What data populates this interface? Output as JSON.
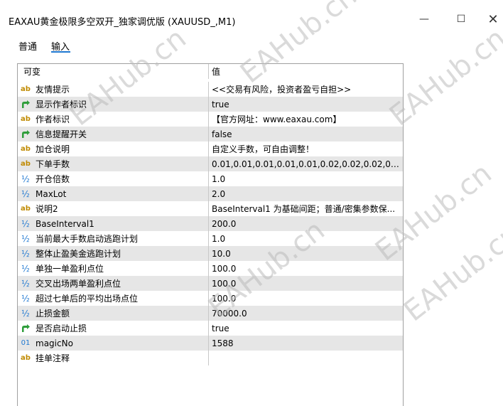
{
  "window": {
    "title": "EAXAU黄金极限多空双开_独家调优版 (XAUUSD_,M1)",
    "minimize_symbol": "—",
    "maximize_symbol": "☐",
    "close_symbol": "✕"
  },
  "tabs": [
    "普通",
    "输入"
  ],
  "table": {
    "header": {
      "name": "可变",
      "value": "值"
    },
    "rows": [
      {
        "icon": "ab",
        "name": "友情提示",
        "value": "<<交易有风险，投资者盈亏自担>>"
      },
      {
        "icon": "bool",
        "name": "显示作者标识",
        "value": "true"
      },
      {
        "icon": "ab",
        "name": "作者标识",
        "value": "【官方网址：www.eaxau.com】"
      },
      {
        "icon": "bool",
        "name": "信息提醒开关",
        "value": "false"
      },
      {
        "icon": "ab",
        "name": "加仓说明",
        "value": "自定义手数，可自由调整！"
      },
      {
        "icon": "ab",
        "name": "下单手数",
        "value": "0.01,0.01,0.01,0.01,0.01,0.02,0.02,0.02,0.02,0...."
      },
      {
        "icon": "half",
        "name": "开仓倍数",
        "value": "1.0"
      },
      {
        "icon": "half",
        "name": "MaxLot",
        "value": "2.0"
      },
      {
        "icon": "ab",
        "name": "说明2",
        "value": "BaseInterval1 为基础间距；普通/密集参数保..."
      },
      {
        "icon": "half",
        "name": "BaseInterval1",
        "value": "200.0"
      },
      {
        "icon": "half",
        "name": "当前最大手数启动逃跑计划",
        "value": "1.0"
      },
      {
        "icon": "half",
        "name": "整体止盈美金逃跑计划",
        "value": "10.0"
      },
      {
        "icon": "half",
        "name": "单独一单盈利点位",
        "value": "100.0"
      },
      {
        "icon": "half",
        "name": "交叉出场两单盈利点位",
        "value": "100.0"
      },
      {
        "icon": "half",
        "name": "超过七单后的平均出场点位",
        "value": "100.0"
      },
      {
        "icon": "half",
        "name": "止损金额",
        "value": "70000.0"
      },
      {
        "icon": "bool",
        "name": "是否启动止损",
        "value": "true"
      },
      {
        "icon": "01",
        "name": "magicNo",
        "value": "1588"
      },
      {
        "icon": "ab",
        "name": "挂单注释",
        "value": ""
      }
    ]
  },
  "watermark": "EAHub.cn",
  "colors": {
    "shaded_row": "#e6e6e6",
    "tab_accent": "#1f78d1",
    "ab_icon": "#c08a00",
    "half_icon": "#1f78d1",
    "bool_icon": "#2e9d3a"
  }
}
